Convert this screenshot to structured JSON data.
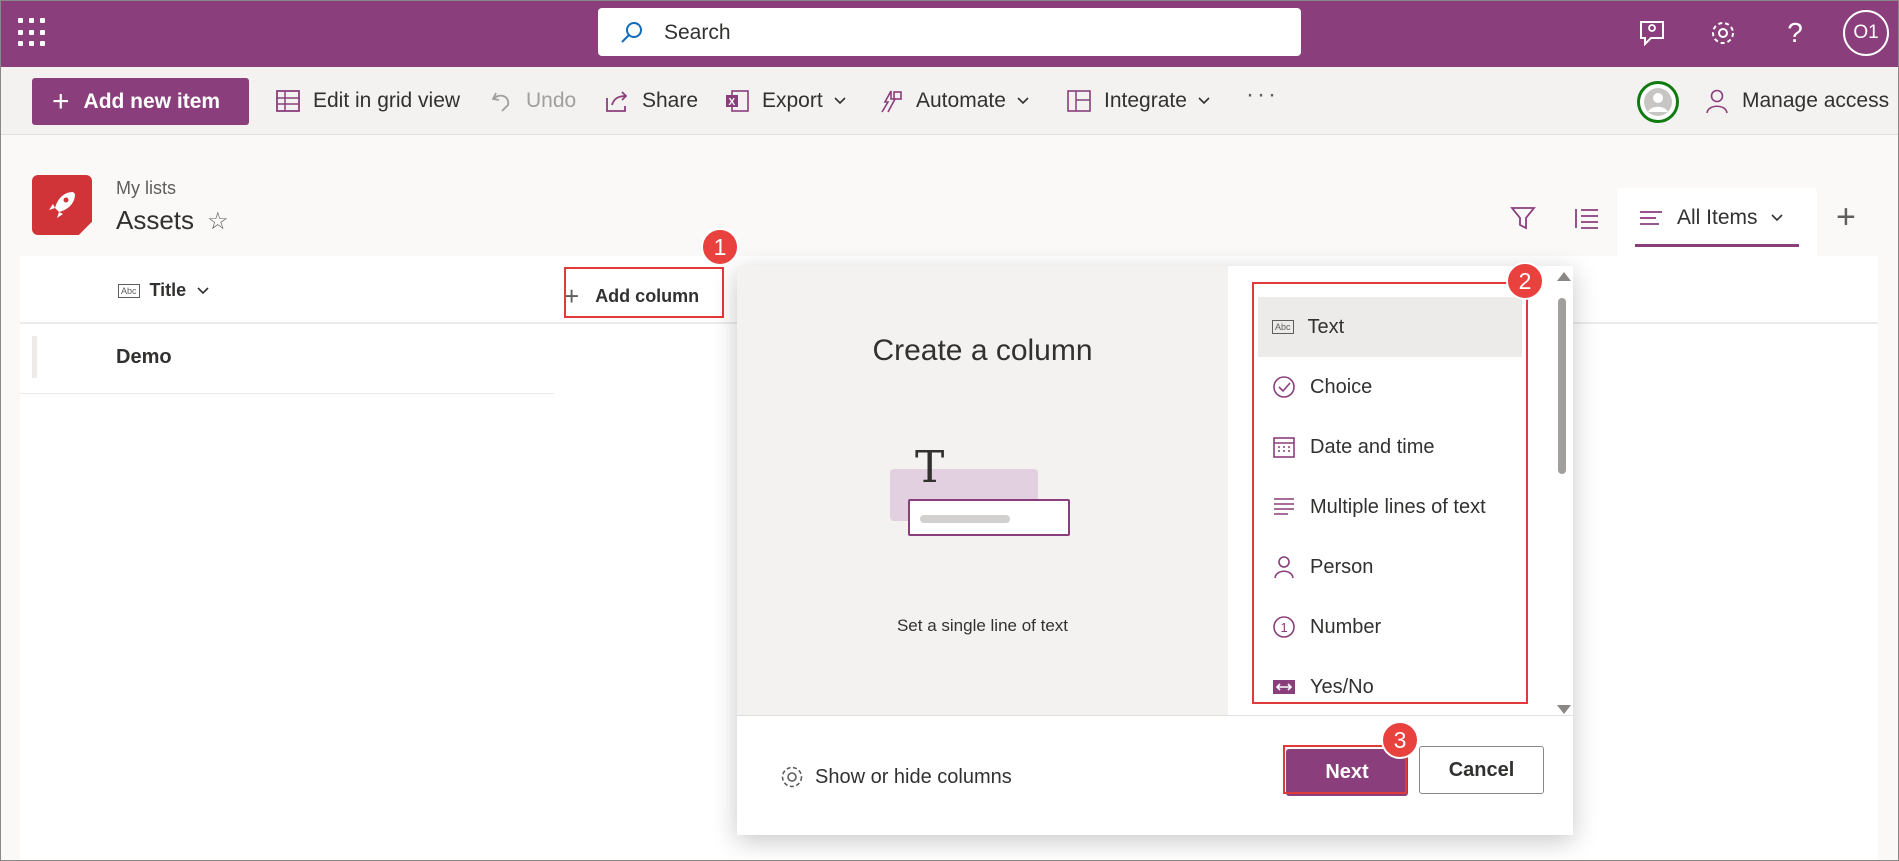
{
  "suite_bar": {
    "search_placeholder": "Search",
    "avatar_initials": "O1"
  },
  "command_bar": {
    "add_new_item": "Add new item",
    "edit_grid": "Edit in grid view",
    "undo": "Undo",
    "share": "Share",
    "export": "Export",
    "automate": "Automate",
    "integrate": "Integrate",
    "more": "···",
    "manage_access": "Manage access"
  },
  "header": {
    "breadcrumb": "My lists",
    "title": "Assets",
    "view_name": "All Items"
  },
  "list": {
    "columns": {
      "title": "Title",
      "add_column": "Add column"
    },
    "rows": [
      "Demo"
    ]
  },
  "panel": {
    "title": "Create a column",
    "description": "Set a single line of text",
    "types": [
      "Text",
      "Choice",
      "Date and time",
      "Multiple lines of text",
      "Person",
      "Number",
      "Yes/No"
    ],
    "selected_type": "Text",
    "show_hide": "Show or hide columns",
    "next": "Next",
    "cancel": "Cancel"
  },
  "annotations": {
    "badge1": "1",
    "badge2": "2",
    "badge3": "3"
  },
  "colors": {
    "brand": "#8a3f7c",
    "highlight": "#e03a3a",
    "list_icon": "#d13438"
  }
}
